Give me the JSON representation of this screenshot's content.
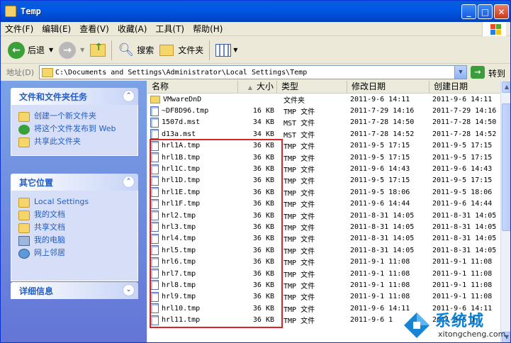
{
  "window": {
    "title": "Temp"
  },
  "menu": [
    "文件(F)",
    "编辑(E)",
    "查看(V)",
    "收藏(A)",
    "工具(T)",
    "帮助(H)"
  ],
  "toolbar": {
    "back": "后退",
    "search": "搜索",
    "folders": "文件夹"
  },
  "address": {
    "label": "地址(D)",
    "path": "C:\\Documents and Settings\\Administrator\\Local Settings\\Temp",
    "go": "转到"
  },
  "tasks": {
    "title": "文件和文件夹任务",
    "items": [
      "创建一个新文件夹",
      "将这个文件发布到 Web",
      "共享此文件夹"
    ]
  },
  "places": {
    "title": "其它位置",
    "items": [
      "Local Settings",
      "我的文档",
      "共享文档",
      "我的电脑",
      "网上邻居"
    ]
  },
  "details": {
    "title": "详细信息"
  },
  "columns": {
    "name": "名称",
    "size": "大小",
    "type": "类型",
    "modified": "修改日期",
    "created": "创建日期"
  },
  "files": [
    {
      "name": "VMwareDnD",
      "size": "",
      "type": "文件夹",
      "modified": "2011-9-6 14:11",
      "created": "2011-9-6 14:11"
    },
    {
      "name": "~DF8D96.tmp",
      "size": "16 KB",
      "type": "TMP 文件",
      "modified": "2011-7-29 14:16",
      "created": "2011-7-29 14:16"
    },
    {
      "name": "1507d.mst",
      "size": "34 KB",
      "type": "MST 文件",
      "modified": "2011-7-28 14:50",
      "created": "2011-7-28 14:50"
    },
    {
      "name": "d13a.mst",
      "size": "34 KB",
      "type": "MST 文件",
      "modified": "2011-7-28 14:52",
      "created": "2011-7-28 14:52"
    },
    {
      "name": "hrl1A.tmp",
      "size": "36 KB",
      "type": "TMP 文件",
      "modified": "2011-9-5 17:15",
      "created": "2011-9-5 17:15"
    },
    {
      "name": "hrl1B.tmp",
      "size": "36 KB",
      "type": "TMP 文件",
      "modified": "2011-9-5 17:15",
      "created": "2011-9-5 17:15"
    },
    {
      "name": "hrl1C.tmp",
      "size": "36 KB",
      "type": "TMP 文件",
      "modified": "2011-9-6 14:43",
      "created": "2011-9-6 14:43"
    },
    {
      "name": "hrl1D.tmp",
      "size": "36 KB",
      "type": "TMP 文件",
      "modified": "2011-9-5 17:15",
      "created": "2011-9-5 17:15"
    },
    {
      "name": "hrl1E.tmp",
      "size": "36 KB",
      "type": "TMP 文件",
      "modified": "2011-9-5 18:06",
      "created": "2011-9-5 18:06"
    },
    {
      "name": "hrl1F.tmp",
      "size": "36 KB",
      "type": "TMP 文件",
      "modified": "2011-9-6 14:44",
      "created": "2011-9-6 14:44"
    },
    {
      "name": "hrl2.tmp",
      "size": "36 KB",
      "type": "TMP 文件",
      "modified": "2011-8-31 14:05",
      "created": "2011-8-31 14:05"
    },
    {
      "name": "hrl3.tmp",
      "size": "36 KB",
      "type": "TMP 文件",
      "modified": "2011-8-31 14:05",
      "created": "2011-8-31 14:05"
    },
    {
      "name": "hrl4.tmp",
      "size": "36 KB",
      "type": "TMP 文件",
      "modified": "2011-8-31 14:05",
      "created": "2011-8-31 14:05"
    },
    {
      "name": "hrl5.tmp",
      "size": "36 KB",
      "type": "TMP 文件",
      "modified": "2011-8-31 14:05",
      "created": "2011-8-31 14:05"
    },
    {
      "name": "hrl6.tmp",
      "size": "36 KB",
      "type": "TMP 文件",
      "modified": "2011-9-1 11:08",
      "created": "2011-9-1 11:08"
    },
    {
      "name": "hrl7.tmp",
      "size": "36 KB",
      "type": "TMP 文件",
      "modified": "2011-9-1 11:08",
      "created": "2011-9-1 11:08"
    },
    {
      "name": "hrl8.tmp",
      "size": "36 KB",
      "type": "TMP 文件",
      "modified": "2011-9-1 11:08",
      "created": "2011-9-1 11:08"
    },
    {
      "name": "hrl9.tmp",
      "size": "36 KB",
      "type": "TMP 文件",
      "modified": "2011-9-1 11:08",
      "created": "2011-9-1 11:08"
    },
    {
      "name": "hrl10.tmp",
      "size": "36 KB",
      "type": "TMP 文件",
      "modified": "2011-9-6 14:11",
      "created": "2011-9-6 14:11"
    },
    {
      "name": "hrl11.tmp",
      "size": "36 KB",
      "type": "TMP 文件",
      "modified": "2011-9-6 1",
      "created": "2011-9-6 1"
    }
  ],
  "watermark": {
    "brand": "系统城",
    "url": "xitongcheng.com"
  }
}
